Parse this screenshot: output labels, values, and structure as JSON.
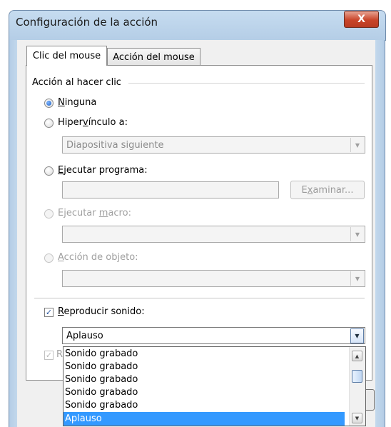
{
  "window": {
    "title": "Configuración de la acción",
    "close_glyph": "X"
  },
  "tabs": [
    {
      "label": "Clic del mouse",
      "active": true
    },
    {
      "label": "Acción del mouse",
      "active": false
    }
  ],
  "group": {
    "label": "Acción al hacer clic",
    "options": {
      "ninguna": {
        "pre": "",
        "key": "N",
        "post": "inguna",
        "checked": true
      },
      "hipervinculo": {
        "pre": "Hiper",
        "key": "v",
        "post": "ínculo a:",
        "combo_value": "Diapositiva siguiente"
      },
      "ejecutar_programa": {
        "pre": "",
        "key": "E",
        "post": "jecutar programa:",
        "field_value": "",
        "button": {
          "pre": "E",
          "key": "x",
          "post": "aminar..."
        }
      },
      "ejecutar_macro": {
        "pre": "Ejecutar ",
        "key": "m",
        "post": "acro:",
        "combo_value": ""
      },
      "accion_objeto": {
        "pre": "",
        "key": "A",
        "post": "cción de objeto:",
        "combo_value": ""
      }
    }
  },
  "sound": {
    "checked": true,
    "label": {
      "pre": "",
      "key": "R",
      "post": "eproducir sonido:"
    },
    "value": "Aplauso",
    "second_check_visible_label": "R"
  },
  "dropdown": {
    "items": [
      "Sonido grabado",
      "Sonido grabado",
      "Sonido grabado",
      "Sonido grabado",
      "Sonido grabado",
      "Aplauso"
    ],
    "selected_index": 5
  },
  "icons": {
    "close": "close-icon",
    "combo_arrow": "chevron-down-icon",
    "check": "check-icon",
    "scroll_up": "scroll-up-icon",
    "scroll_down": "scroll-down-icon"
  },
  "colors": {
    "selection": "#3399ff",
    "close_button": "#c9452a",
    "frame": "#b4cde6"
  }
}
